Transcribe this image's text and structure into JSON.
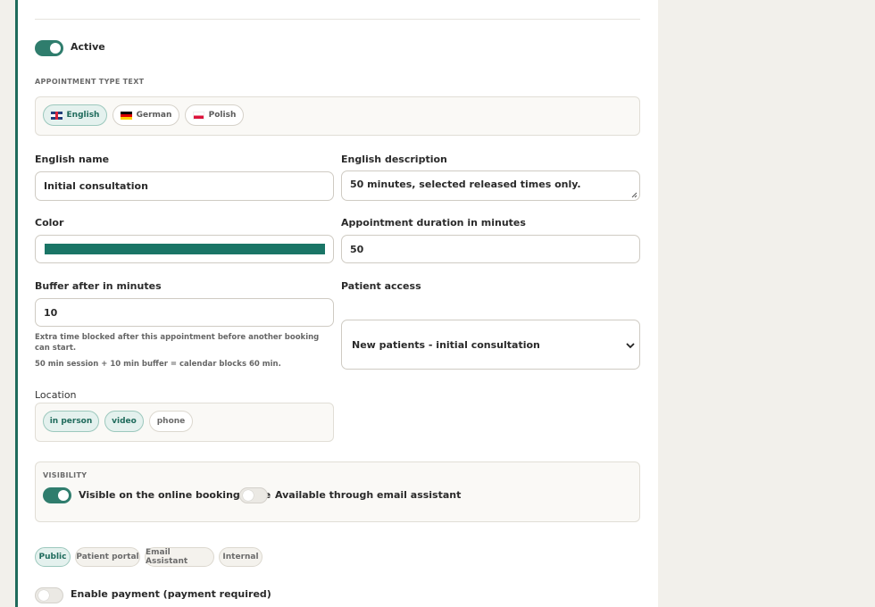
{
  "active": {
    "label": "Active",
    "on": true
  },
  "text_section": {
    "caption": "APPOINTMENT TYPE TEXT",
    "languages": [
      {
        "label": "English",
        "flag": "flag-gb",
        "selected": true
      },
      {
        "label": "German",
        "flag": "flag-de",
        "selected": false
      },
      {
        "label": "Polish",
        "flag": "flag-pl",
        "selected": false
      }
    ]
  },
  "fields": {
    "name_label": "English name",
    "name_value": "Initial consultation",
    "description_label": "English description",
    "description_value": "50 minutes, selected released times only.",
    "color_label": "Color",
    "color_value": "#1a7566",
    "duration_label": "Appointment duration in minutes",
    "duration_value": "50",
    "buffer_label": "Buffer after in minutes",
    "buffer_value": "10",
    "buffer_help": "Extra time blocked after this appointment before another booking can start.",
    "buffer_summary": "50 min session + 10 min buffer = calendar blocks 60 min.",
    "patient_access_label": "Patient access",
    "patient_access_value": "New patients - initial consultation"
  },
  "location": {
    "label": "Location",
    "options": [
      {
        "label": "in person",
        "selected": true
      },
      {
        "label": "video",
        "selected": true
      },
      {
        "label": "phone",
        "selected": false
      }
    ]
  },
  "visibility": {
    "caption": "VISIBILITY",
    "booking_page_label": "Visible on the online booking page",
    "booking_page_on": true,
    "email_assistant_label": "Available through email assistant",
    "email_assistant_on": false
  },
  "audiences": [
    {
      "label": "Public",
      "selected": true
    },
    {
      "label": "Patient portal",
      "selected": false
    },
    {
      "label": "Email Assistant",
      "selected": false
    },
    {
      "label": "Internal",
      "selected": false
    }
  ],
  "payment": {
    "label": "Enable payment (payment required)",
    "on": false
  },
  "colors": {
    "accent": "#2f7d6d",
    "border_accent": "#1f6b5c",
    "page_bg": "#f2f0eb"
  }
}
